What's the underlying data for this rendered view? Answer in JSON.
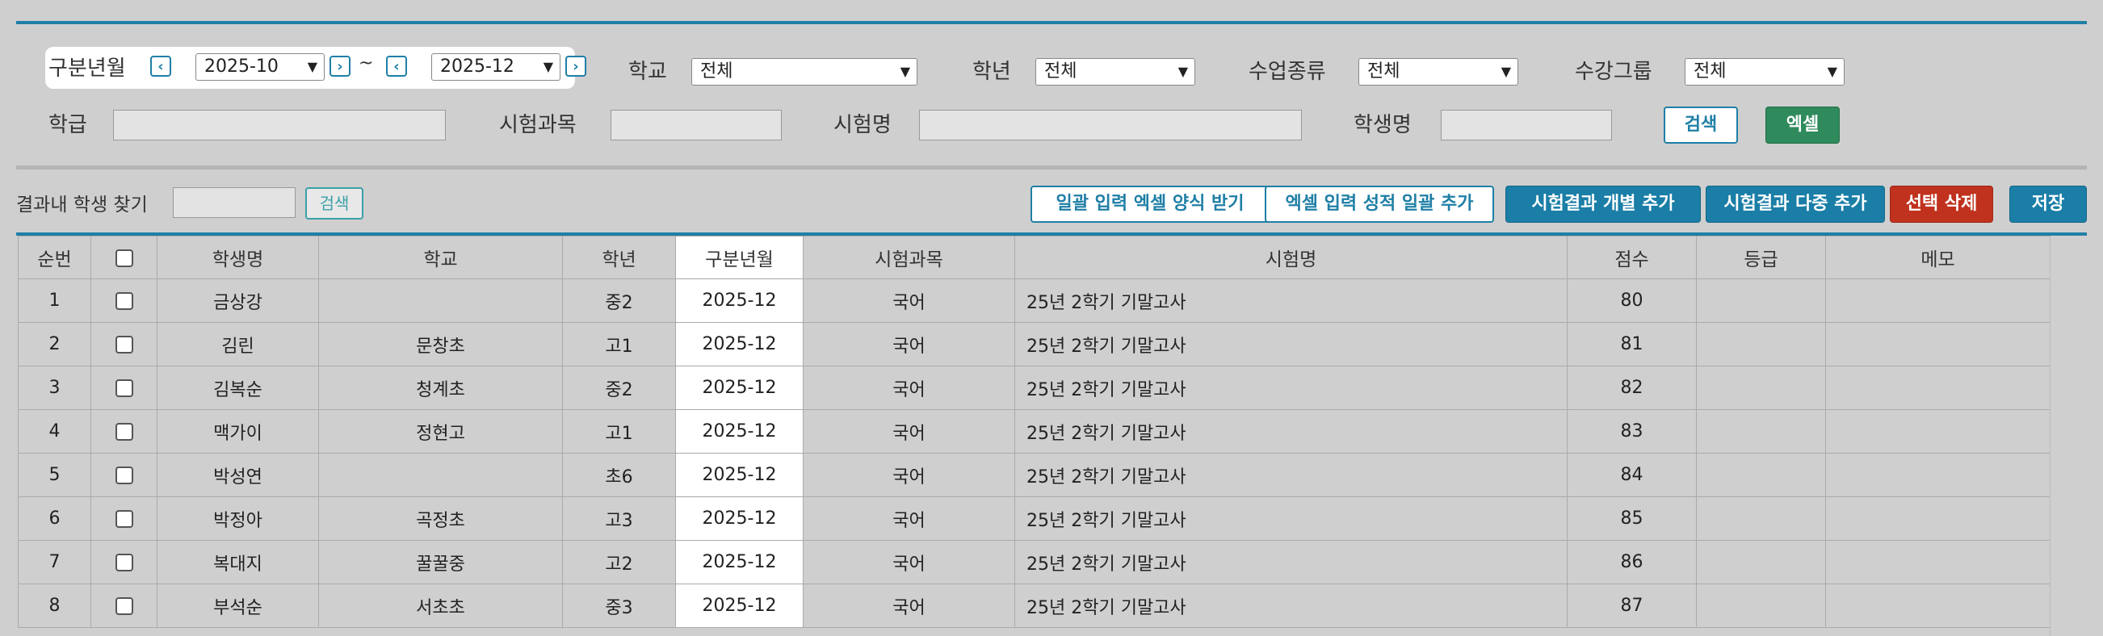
{
  "filters": {
    "period_label": "구분년월",
    "period_from": "2025-10",
    "period_to": "2025-12",
    "tilde": "~",
    "prev_icon": "‹",
    "next_icon": "›",
    "school_label": "학교",
    "school_value": "전체",
    "grade_label": "학년",
    "grade_value": "전체",
    "class_type_label": "수업종류",
    "class_type_value": "전체",
    "group_label": "수강그룹",
    "group_value": "전체",
    "level_label": "학급",
    "subject_label": "시험과목",
    "exam_label": "시험명",
    "student_label": "학생명",
    "search_button": "검색",
    "excel_button": "엑셀"
  },
  "toolbar": {
    "find_label": "결과내 학생 찾기",
    "find_button": "검색",
    "bulk_template_button": "일괄 입력 엑셀 양식 받기",
    "bulk_add_button": "엑셀 입력 성적 일괄 추가",
    "add_single_button": "시험결과 개별 추가",
    "add_multi_button": "시험결과 다중 추가",
    "delete_button": "선택 삭제",
    "save_button": "저장"
  },
  "table": {
    "headers": [
      "순번",
      "",
      "학생명",
      "학교",
      "학년",
      "구분년월",
      "시험과목",
      "시험명",
      "점수",
      "등급",
      "메모"
    ],
    "rows": [
      {
        "no": "1",
        "name": "금상강",
        "school": "",
        "grade": "중2",
        "period": "2025-12",
        "subject": "국어",
        "exam": "25년 2학기 기말고사",
        "score": "80",
        "rank": "",
        "memo": ""
      },
      {
        "no": "2",
        "name": "김린",
        "school": "문창초",
        "grade": "고1",
        "period": "2025-12",
        "subject": "국어",
        "exam": "25년 2학기 기말고사",
        "score": "81",
        "rank": "",
        "memo": ""
      },
      {
        "no": "3",
        "name": "김복순",
        "school": "청계초",
        "grade": "중2",
        "period": "2025-12",
        "subject": "국어",
        "exam": "25년 2학기 기말고사",
        "score": "82",
        "rank": "",
        "memo": ""
      },
      {
        "no": "4",
        "name": "맥가이",
        "school": "정현고",
        "grade": "고1",
        "period": "2025-12",
        "subject": "국어",
        "exam": "25년 2학기 기말고사",
        "score": "83",
        "rank": "",
        "memo": ""
      },
      {
        "no": "5",
        "name": "박성연",
        "school": "",
        "grade": "초6",
        "period": "2025-12",
        "subject": "국어",
        "exam": "25년 2학기 기말고사",
        "score": "84",
        "rank": "",
        "memo": ""
      },
      {
        "no": "6",
        "name": "박정아",
        "school": "곡정초",
        "grade": "고3",
        "period": "2025-12",
        "subject": "국어",
        "exam": "25년 2학기 기말고사",
        "score": "85",
        "rank": "",
        "memo": ""
      },
      {
        "no": "7",
        "name": "복대지",
        "school": "꿀꿀중",
        "grade": "고2",
        "period": "2025-12",
        "subject": "국어",
        "exam": "25년 2학기 기말고사",
        "score": "86",
        "rank": "",
        "memo": ""
      },
      {
        "no": "8",
        "name": "부석순",
        "school": "서초초",
        "grade": "중3",
        "period": "2025-12",
        "subject": "국어",
        "exam": "25년 2학기 기말고사",
        "score": "87",
        "rank": "",
        "memo": ""
      }
    ]
  }
}
